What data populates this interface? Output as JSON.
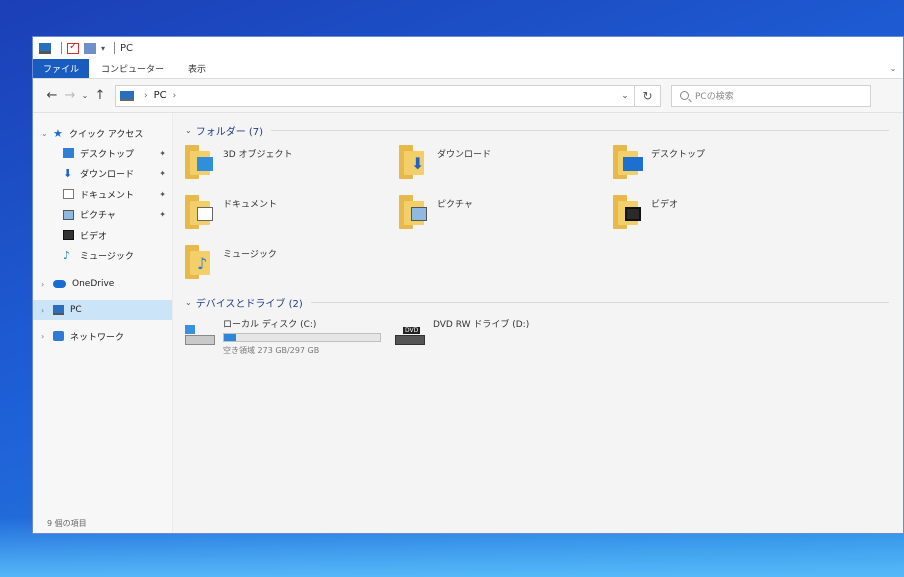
{
  "window": {
    "title": "PC",
    "ribbon_tabs": [
      "ファイル",
      "コンピューター",
      "表示"
    ],
    "ribbon_expand_glyph": "⌄"
  },
  "navbar": {
    "back_glyph": "←",
    "forward_glyph": "→",
    "recent_glyph": "⌄",
    "up_glyph": "↑",
    "breadcrumb": "PC",
    "breadcrumb_sep": "›",
    "dropdown_glyph": "⌄",
    "refresh_glyph": "↻",
    "search_placeholder": "PCの検索"
  },
  "sidebar": {
    "quick_access": {
      "label": "クイック アクセス",
      "items": [
        {
          "label": "デスクトップ",
          "icon": "desktop-icon",
          "pinned": true
        },
        {
          "label": "ダウンロード",
          "icon": "download-icon",
          "pinned": true
        },
        {
          "label": "ドキュメント",
          "icon": "document-icon",
          "pinned": true
        },
        {
          "label": "ピクチャ",
          "icon": "picture-icon",
          "pinned": true
        },
        {
          "label": "ビデオ",
          "icon": "video-icon",
          "pinned": false
        },
        {
          "label": "ミュージック",
          "icon": "music-icon",
          "pinned": false
        }
      ]
    },
    "onedrive": "OneDrive",
    "pc": "PC",
    "network": "ネットワーク",
    "pin_glyph": "📌",
    "chevron_open": "⌄",
    "chevron_closed": "›"
  },
  "main": {
    "folders_header": "フォルダー (7)",
    "folders": [
      {
        "label": "3D オブジェクト",
        "icon": "3d-objects-icon"
      },
      {
        "label": "ダウンロード",
        "icon": "downloads-folder-icon"
      },
      {
        "label": "デスクトップ",
        "icon": "desktop-folder-icon"
      },
      {
        "label": "ドキュメント",
        "icon": "documents-folder-icon"
      },
      {
        "label": "ピクチャ",
        "icon": "pictures-folder-icon"
      },
      {
        "label": "ビデオ",
        "icon": "videos-folder-icon"
      },
      {
        "label": "ミュージック",
        "icon": "music-folder-icon"
      }
    ],
    "drives_header": "デバイスとドライブ (2)",
    "drives": [
      {
        "label": "ローカル ディスク (C:)",
        "free_text": "空き領域 273 GB/297 GB",
        "used_fraction": 0.08
      },
      {
        "label": "DVD RW ドライブ (D:)",
        "badge": "DVD"
      }
    ]
  },
  "status": {
    "item_count": "9 個の項目"
  },
  "colors": {
    "accent": "#1a5bbf",
    "selection": "#cce4f7",
    "folder": "#f3cf6a",
    "desktop_bg": "#1e5fd6"
  }
}
